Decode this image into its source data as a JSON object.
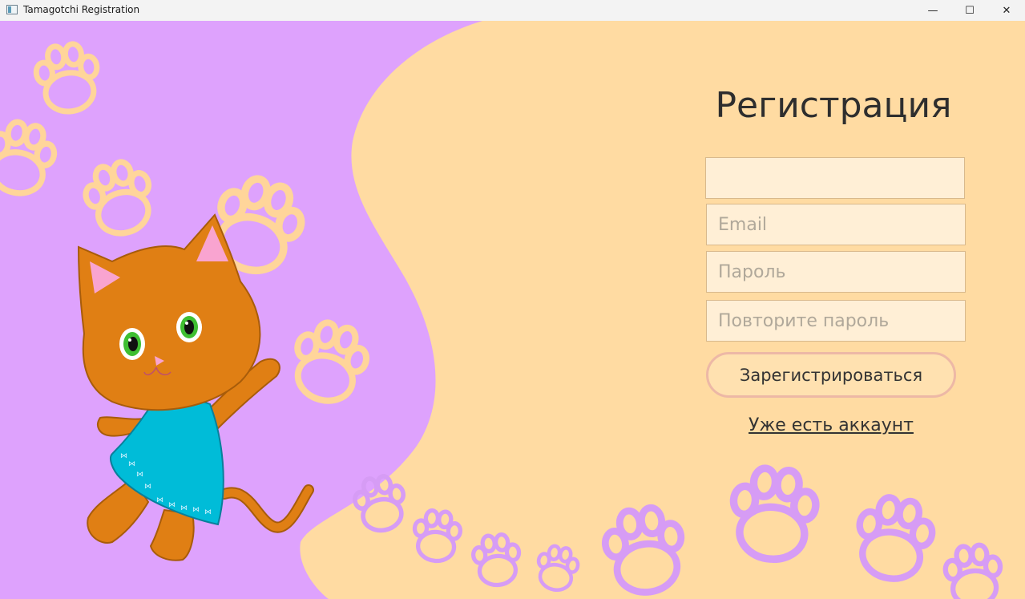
{
  "window": {
    "title": "Tamagotchi Registration",
    "minimize_glyph": "—",
    "maximize_glyph": "☐",
    "close_glyph": "✕"
  },
  "form": {
    "heading": "Регистрация",
    "name_value": "",
    "email_placeholder": "Email",
    "password_placeholder": "Пароль",
    "repeat_password_placeholder": "Повторите пароль",
    "submit_label": "Зарегистрироваться",
    "login_link": "Уже есть аккаунт"
  },
  "colors": {
    "left_panel": "#dea2fd",
    "right_panel": "#ffdba2",
    "paw_on_purple": "#ffd59a",
    "paw_on_peach": "#d69cf5",
    "cat_fur": "#e07f14",
    "cat_dress": "#00bcd8"
  },
  "icons": [
    "app-icon",
    "minimize-icon",
    "maximize-icon",
    "close-icon",
    "paw-print-icon",
    "cat-illustration"
  ]
}
